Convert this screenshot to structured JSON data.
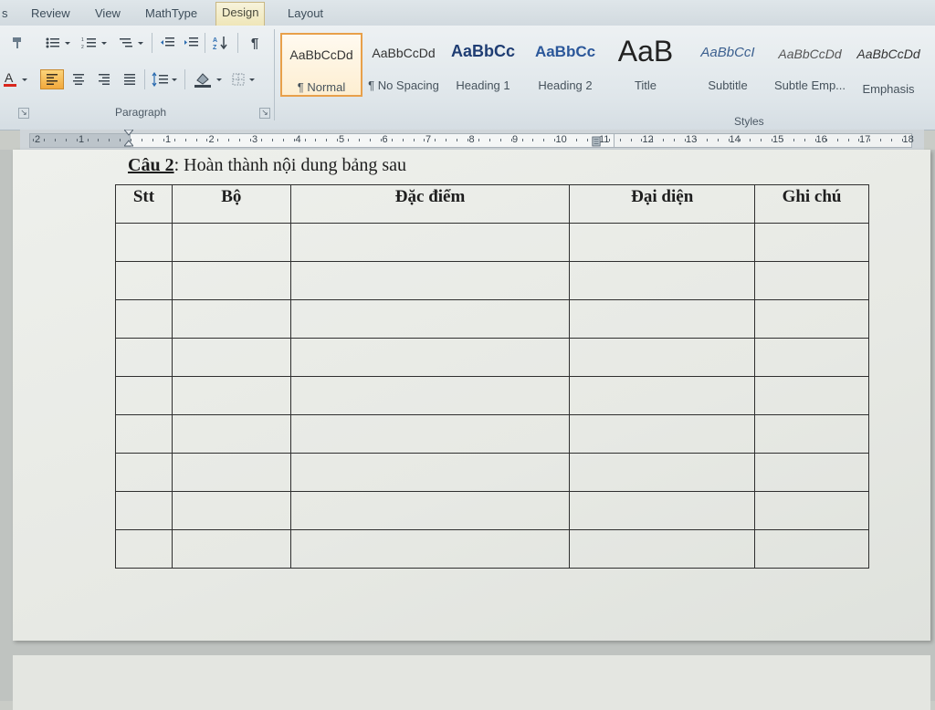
{
  "tabs": {
    "items": [
      "s",
      "Review",
      "View",
      "MathType",
      "Design",
      "Layout"
    ],
    "active": "Design"
  },
  "ribbon": {
    "paragraph_label": "Paragraph",
    "styles_label": "Styles",
    "styles": [
      {
        "sample": "AaBbCcDd",
        "name": "¶ Normal"
      },
      {
        "sample": "AaBbCcDd",
        "name": "¶ No Spacing"
      },
      {
        "sample": "AaBbCc",
        "name": "Heading 1"
      },
      {
        "sample": "AaBbCc",
        "name": "Heading 2"
      },
      {
        "sample": "AaB",
        "name": "Title"
      },
      {
        "sample": "AaBbCcI",
        "name": "Subtitle"
      },
      {
        "sample": "AaBbCcDd",
        "name": "Subtle Emp..."
      },
      {
        "sample": "AaBbCcDd",
        "name": "Emphasis"
      }
    ],
    "selected_style": "Normal",
    "colors": {
      "font_color_red": "#d9261c",
      "selected_orange": "#e8a04a",
      "heading_blue": "#2b579a"
    }
  },
  "ruler": {
    "labels": [
      "2",
      "1",
      "1",
      "2",
      "3",
      "4",
      "5",
      "6",
      "7",
      "8",
      "9",
      "10",
      "11",
      "12",
      "13",
      "14",
      "15",
      "16",
      "17",
      "18"
    ]
  },
  "document": {
    "question_label": "Câu 2",
    "question_text": ": Hoàn thành nội dung bảng sau",
    "table": {
      "headers": [
        "Stt",
        "Bộ",
        "Đặc điểm",
        "Đại diện",
        "Ghi chú"
      ],
      "empty_rows": 9
    }
  }
}
